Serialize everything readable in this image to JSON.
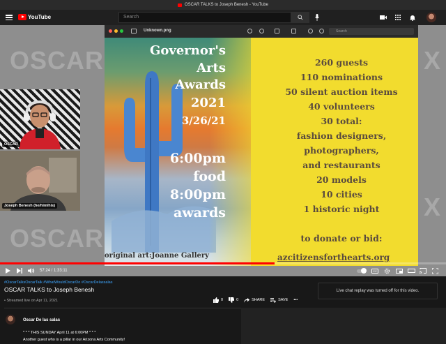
{
  "window": {
    "title": "OSCAR TALKS to Joseph Benesh - YouTube"
  },
  "header": {
    "logo_text": "YouTube",
    "search_placeholder": "Search",
    "icons": [
      "menu-icon",
      "search-icon",
      "mic-icon",
      "create-video-icon",
      "apps-grid-icon",
      "notifications-bell-icon",
      "account-avatar"
    ]
  },
  "viewer": {
    "file_name": "Unknown.png",
    "search_placeholder": "Search"
  },
  "poster": {
    "title_lines": [
      "Governor's",
      "Arts",
      "Awards",
      "2021",
      "3/26/21",
      "6:00pm",
      "food",
      "8:00pm",
      "awards"
    ],
    "stats_lines": [
      "260 guests",
      "110 nominations",
      "50 silent auction items",
      "40 volunteers",
      "30 total:",
      "fashion designers,",
      "photographers,",
      "and restaurants",
      "20 models",
      "10 cities",
      "1 historic night",
      "",
      "to donate or bid:"
    ],
    "url": "azcitizensforthearts.org",
    "credit": "original art:Joanne Gallery"
  },
  "cams": {
    "host_label": "OSCAR",
    "guest_label": "Joseph Benesh (he/him/his)"
  },
  "background_text": "OSCAR",
  "player": {
    "time_current": "57:24",
    "time_total": "1:33:11",
    "time_display": "57:24 / 1:33:11",
    "progress_fraction": 0.616,
    "accent": "#ff0000"
  },
  "video": {
    "hashtags": "#OscarTalksOscarTalk #WhatWouldOscarDo #OscarDelassalas",
    "title": "OSCAR TALKS to Joseph Benesh",
    "meta": "• Streamed live on Apr 11, 2021",
    "likes": "0",
    "dislikes": "0",
    "share_label": "SHARE",
    "save_label": "SAVE",
    "more_label": "•••"
  },
  "chat": {
    "message": "Live chat replay was turned off for this video."
  },
  "channel": {
    "name": "Oscar De las salas",
    "description_line1": "* * * THIS SUNDAY April 11 at 6:00PM * * *",
    "description_line2": "Another guest who is a pillar in our Arizona Arts Community!"
  }
}
